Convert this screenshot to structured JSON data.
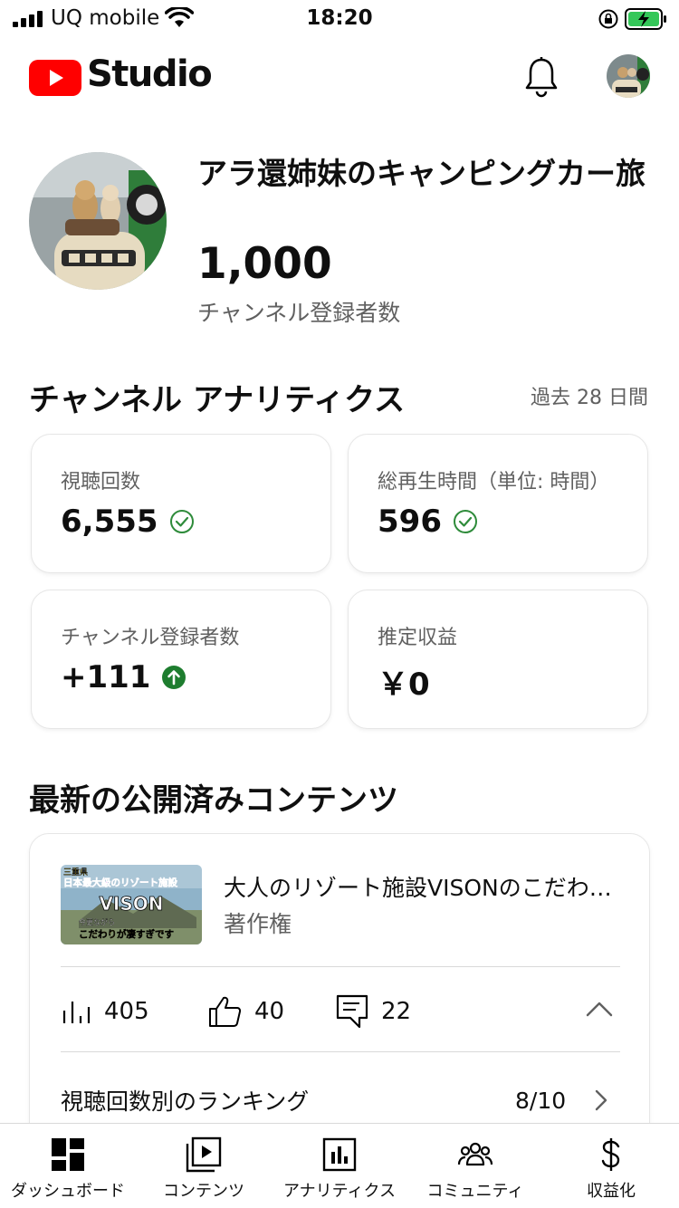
{
  "status_bar": {
    "carrier": "UQ mobile",
    "time": "18:20"
  },
  "header": {
    "logo_text": "Studio",
    "brand_color": "#ff0000"
  },
  "channel": {
    "name": "アラ還姉妹のキャンピングカー旅",
    "subscriber_count": "1,000",
    "subscriber_label": "チャンネル登録者数"
  },
  "analytics": {
    "title": "チャンネル アナリティクス",
    "period": "過去 28 日間",
    "cards": [
      {
        "label": "視聴回数",
        "value": "6,555",
        "status": "check"
      },
      {
        "label": "総再生時間（単位: 時間）",
        "value": "596",
        "status": "check"
      },
      {
        "label": "チャンネル登録者数",
        "value": "+111",
        "status": "up"
      },
      {
        "label": "推定収益",
        "value": "￥0",
        "status": "none"
      }
    ]
  },
  "latest": {
    "title": "最新の公開済みコンテンツ",
    "video": {
      "title": "大人のリゾート施設VISONのこだわりが凄すぎです",
      "subtitle": "著作権",
      "thumb_texts": [
        "三重県",
        "日本最大級のリゾート施設",
        "VISON",
        "今更ながら",
        "こだわりが凄すぎです"
      ],
      "views": "405",
      "likes": "40",
      "comments": "22",
      "ranking_label": "視聴回数別のランキング",
      "ranking_value": "8/10"
    }
  },
  "nav": {
    "items": [
      {
        "label": "ダッシュボード",
        "icon": "dashboard-icon"
      },
      {
        "label": "コンテンツ",
        "icon": "content-icon"
      },
      {
        "label": "アナリティクス",
        "icon": "analytics-icon"
      },
      {
        "label": "コミュニティ",
        "icon": "community-icon"
      },
      {
        "label": "収益化",
        "icon": "monetization-icon"
      }
    ]
  }
}
